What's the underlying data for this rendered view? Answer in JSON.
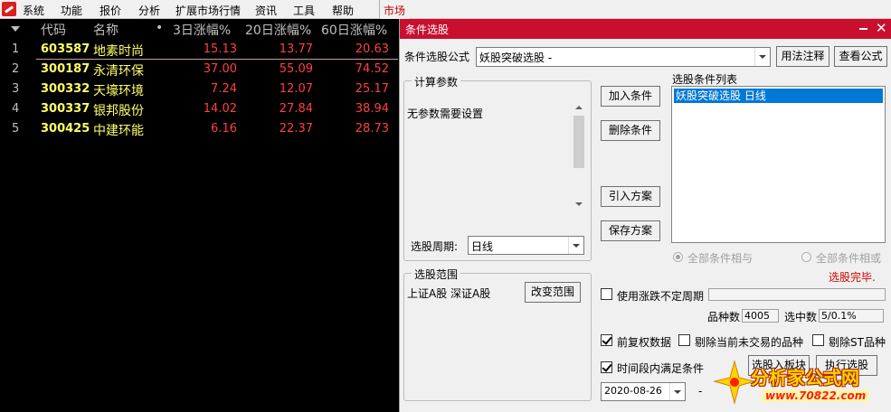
{
  "menu": {
    "items": [
      "系统",
      "功能",
      "报价",
      "分析",
      "扩展市场行情",
      "资讯",
      "工具",
      "帮助"
    ],
    "market": "市场"
  },
  "table": {
    "headers": {
      "code": "代码",
      "name": "名称",
      "dot": "•",
      "c3": "3日涨幅%",
      "c20": "20日涨幅%",
      "c60": "60日涨幅%"
    },
    "rows": [
      {
        "idx": "1",
        "code": "603587",
        "name": "地素时尚",
        "v3": "15.13",
        "v20": "13.77",
        "v60": "20.63"
      },
      {
        "idx": "2",
        "code": "300187",
        "name": "永清环保",
        "v3": "37.00",
        "v20": "55.09",
        "v60": "74.52"
      },
      {
        "idx": "3",
        "code": "300332",
        "name": "天壕环境",
        "v3": "7.24",
        "v20": "12.07",
        "v60": "25.17"
      },
      {
        "idx": "4",
        "code": "300337",
        "name": "银邦股份",
        "v3": "14.02",
        "v20": "27.84",
        "v60": "38.94"
      },
      {
        "idx": "5",
        "code": "300425",
        "name": "中建环能",
        "v3": "6.16",
        "v20": "22.37",
        "v60": "28.73"
      }
    ]
  },
  "dialog": {
    "title": "条件选股",
    "formula_label": "条件选股公式",
    "formula_value": "妖股突破选股 -",
    "usage_btn": "用法注释",
    "view_formula_btn": "查看公式",
    "params_group": "计算参数",
    "params_text": "无参数需要设置",
    "period_label": "选股周期:",
    "period_value": "日线",
    "add_btn": "加入条件",
    "delete_btn": "删除条件",
    "import_btn": "引入方案",
    "save_btn": "保存方案",
    "cond_list_label": "选股条件列表",
    "cond_list_items": [
      "妖股突破选股  日线"
    ],
    "radio_and": "全部条件相与",
    "radio_or": "全部条件相或",
    "status": "选股完毕.",
    "range_group": "选股范围",
    "range_text": "上证A股 深证A股",
    "change_range_btn": "改变范围",
    "use_uncertain_period": "使用涨跌不定周期",
    "count_label": "品种数",
    "count_value": "4005",
    "selected_label": "选中数",
    "selected_value": "5/0.1%",
    "prev_adjust": "前复权数据",
    "exclude_untraded": "剔除当前未交易的品种",
    "exclude_st": "剔除ST品种",
    "period_satisfy": "时间段内满足条件",
    "date_from": "2020-08-26",
    "date_sep": "-",
    "btn_select_into": "选股入板块",
    "btn_execute": "执行选股"
  },
  "watermark": {
    "text": "分析家公式网",
    "url": "www.70822.com"
  }
}
